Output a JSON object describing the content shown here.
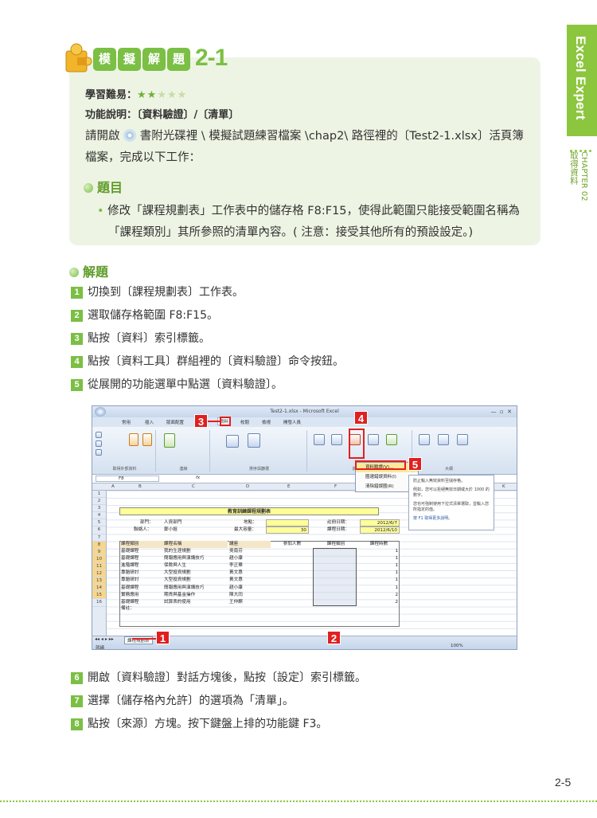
{
  "side_tab": {
    "title": "Excel Expert",
    "chapter": "CHAPTER 02",
    "chapter_title": "取得資料"
  },
  "practice": {
    "badge_chars": [
      "模",
      "擬",
      "解",
      "題"
    ],
    "number": "2-1",
    "difficulty_label": "學習難易：",
    "difficulty_stars_on": "★★",
    "difficulty_stars_off": "★★★",
    "difficulty_value": 2,
    "function_label": "功能說明：",
    "function_value": "〔資料驗證〕/〔清單〕",
    "intro_line1": "請開啟 ",
    "intro_line1b": " 書附光碟裡 \\ 模擬試題練習檔案 \\chap2\\ 路徑裡的〔Test2-1.xlsx〕活頁簿",
    "intro_line2": "檔案，完成以下工作：",
    "question_head": "題目",
    "question_line1": "修改「課程規劃表」工作表中的儲存格 F8:F15，使得此範圍只能接受範圍名稱為",
    "question_line2": "「課程類別」其所參照的清單內容。( 注意：接受其他所有的預設設定。)"
  },
  "solution_head": "解題",
  "steps": [
    {
      "n": "1",
      "text": "切換到〔課程規劃表〕工作表。"
    },
    {
      "n": "2",
      "text": "選取儲存格範圍 F8:F15。"
    },
    {
      "n": "3",
      "text": "點按〔資料〕索引標籤。"
    },
    {
      "n": "4",
      "text": "點按〔資料工具〕群組裡的〔資料驗證〕命令按鈕。"
    },
    {
      "n": "5",
      "text": "從展開的功能選單中點選〔資料驗證〕。"
    },
    {
      "n": "6",
      "text": "開啟〔資料驗證〕對話方塊後，點按〔設定〕索引標籤。"
    },
    {
      "n": "7",
      "text": "選擇〔儲存格內允許〕的選項為「清單」。"
    },
    {
      "n": "8",
      "text": "點按〔來源〕方塊。按下鍵盤上排的功能鍵 F3。"
    }
  ],
  "screenshot": {
    "window_title": "Test2-1.xlsx - Microsoft Excel",
    "tabs": [
      "常用",
      "插入",
      "版面配置",
      "公式",
      "資料",
      "校閱",
      "檢視",
      "開發人員"
    ],
    "groups": [
      "取得外部資料",
      "連線",
      "排序與篩選",
      "資料工具",
      "大綱"
    ],
    "name_box": "F8",
    "columns": [
      "A",
      "B",
      "C",
      "D",
      "E",
      "F",
      "G",
      "H",
      "I",
      "J",
      "K"
    ],
    "rows": [
      "1",
      "2",
      "3",
      "4",
      "5",
      "6",
      "7",
      "8",
      "9",
      "10",
      "11",
      "12",
      "13",
      "14",
      "15",
      "16"
    ],
    "sheet_title": "教育訓練課程規劃表",
    "dept_label": "部門：",
    "dept_value": "人資部門",
    "contact_label": "聯絡人：",
    "contact_value": "鄭小姐",
    "location_label": "地點：",
    "capacity_label": "最大容量：",
    "capacity_value": "30",
    "reg_date_label": "註冊日期：",
    "reg_date_value": "2012/6/7",
    "course_date_label": "課程日期：",
    "course_date_value": "2012/6/10",
    "headers": [
      "課程類別",
      "課程名稱",
      "講座",
      "參加人數",
      "課程類別",
      "課程時數"
    ],
    "table_rows": [
      {
        "cat": "基礎課程",
        "name": "我的生涯規劃",
        "teacher": "吳南芬",
        "hours": "1"
      },
      {
        "cat": "基礎課程",
        "name": "簡報應用與演講技巧",
        "teacher": "趙小康",
        "hours": "1"
      },
      {
        "cat": "進階課程",
        "name": "保險與人生",
        "teacher": "李正華",
        "hours": "1"
      },
      {
        "cat": "專題研討",
        "name": "大型投資規劃",
        "teacher": "黃文惠",
        "hours": "1"
      },
      {
        "cat": "專題研討",
        "name": "大型投資規劃",
        "teacher": "黃文惠",
        "hours": "1"
      },
      {
        "cat": "基礎課程",
        "name": "簡報應用與演講技巧",
        "teacher": "趙小康",
        "hours": "1"
      },
      {
        "cat": "實務應用",
        "name": "期貨與基金操作",
        "teacher": "陳大同",
        "hours": "2"
      },
      {
        "cat": "基礎課程",
        "name": "試算表的使用",
        "teacher": "王仲麒",
        "hours": "2"
      }
    ],
    "note_label": "備註：",
    "sheet_tab": "課程規劃表",
    "status": "就緒",
    "zoom": "100%",
    "menu_items": [
      "資料驗證(V)...",
      "圈選錯誤資料(I)",
      "清除錯誤圈(R)"
    ],
    "tooltip_lines": [
      "防止輸入無效資料至儲存格。",
      "例如，您可以拒絕無效日期或大於 1000 的數字。",
      "您也可強制使用下拉式清單選取，並輸入您所指定的值。",
      "按 F1 取得更多說明。"
    ],
    "callouts": [
      "1",
      "2",
      "3",
      "4",
      "5"
    ]
  },
  "page_number": "2-5"
}
